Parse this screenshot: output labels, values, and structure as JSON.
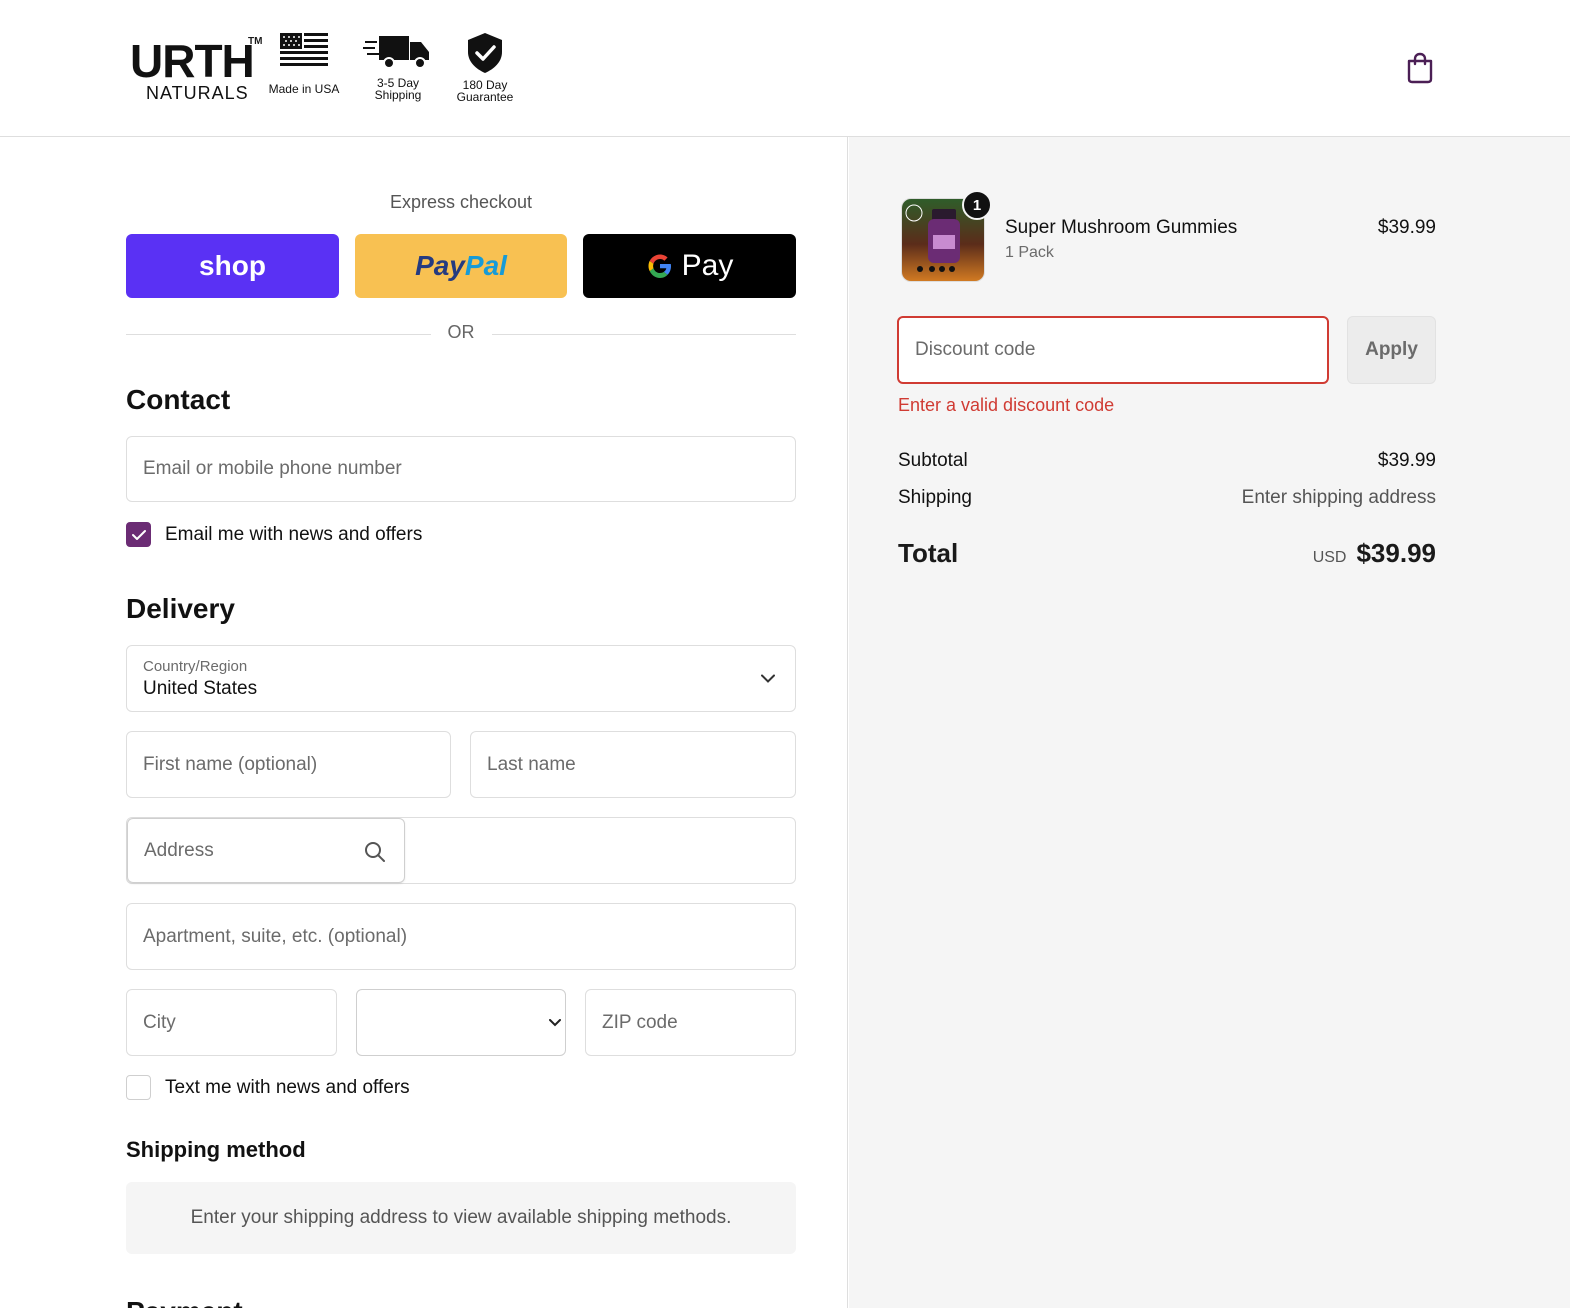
{
  "header": {
    "brand": "URTH",
    "brand_tm": "TM",
    "brand_sub": "NATURALS",
    "badges": {
      "usa": "Made in USA",
      "shipping_line1": "3-5 Day",
      "shipping_line2": "Shipping",
      "guarantee_line1": "180 Day",
      "guarantee_line2": "Guarantee"
    },
    "cart_icon": "shopping-bag-icon"
  },
  "express": {
    "title": "Express checkout",
    "shop_label": "shop",
    "paypal_part1": "Pay",
    "paypal_part2": "Pal",
    "gpay_g": "G",
    "gpay_label": "Pay",
    "or_label": "OR"
  },
  "contact": {
    "title": "Contact",
    "email_placeholder": "Email or mobile phone number",
    "news_label": "Email me with news and offers",
    "news_checked": true
  },
  "delivery": {
    "title": "Delivery",
    "country_label": "Country/Region",
    "country_value": "United States",
    "first_name_placeholder": "First name (optional)",
    "last_name_placeholder": "Last name",
    "address_placeholder": "Address",
    "apartment_placeholder": "Apartment, suite, etc. (optional)",
    "city_placeholder": "City",
    "state_value": "",
    "zip_placeholder": "ZIP code",
    "text_news_label": "Text me with news and offers",
    "text_news_checked": false
  },
  "shipping_method": {
    "title": "Shipping method",
    "note": "Enter your shipping address to view available shipping methods."
  },
  "payment": {
    "title": "Payment"
  },
  "order": {
    "item": {
      "name": "Super Mushroom Gummies",
      "variant": "1 Pack",
      "price": "$39.99",
      "quantity": "1"
    },
    "discount_placeholder": "Discount code",
    "apply_label": "Apply",
    "discount_error": "Enter a valid discount code",
    "subtotal_label": "Subtotal",
    "subtotal_value": "$39.99",
    "shipping_label": "Shipping",
    "shipping_value": "Enter shipping address",
    "total_label": "Total",
    "currency": "USD",
    "total_value": "$39.99"
  },
  "colors": {
    "shop": "#5a31f4",
    "paypal": "#f8c152",
    "gpay": "#000000",
    "checkbox": "#6b2c74",
    "error": "#d03b33",
    "summary_bg": "#f5f5f5"
  }
}
